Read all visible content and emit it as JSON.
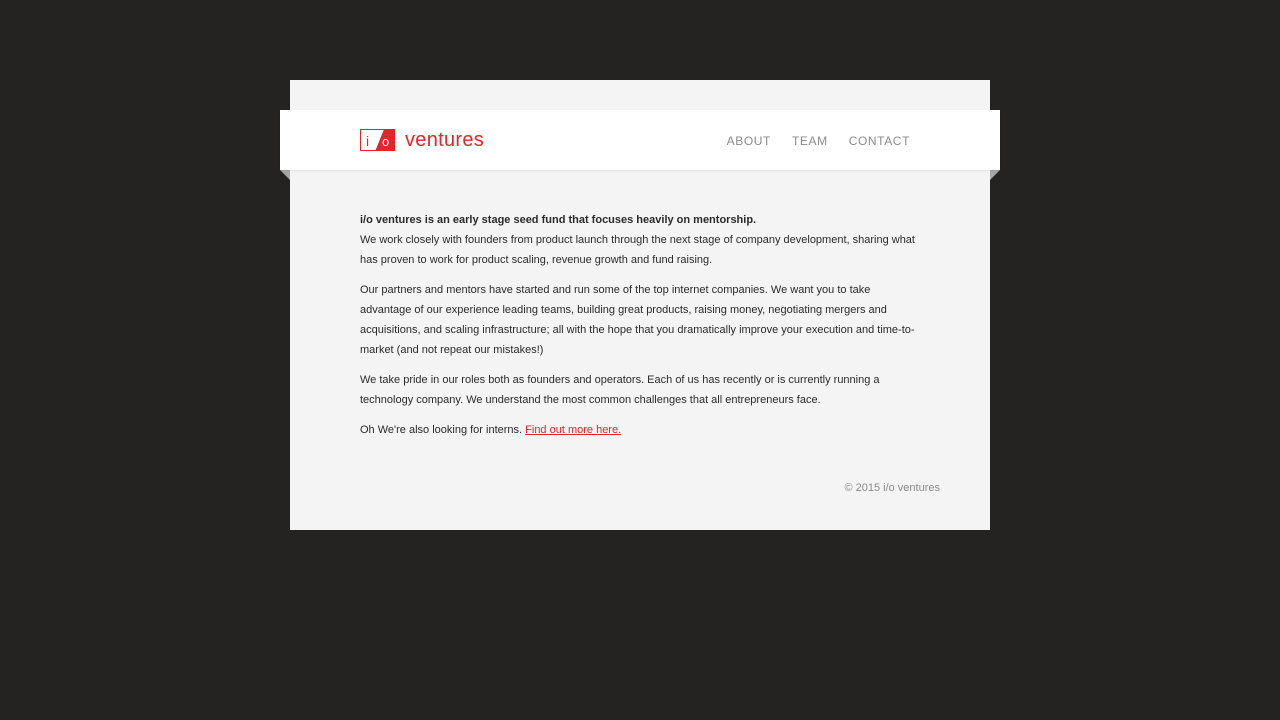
{
  "header": {
    "logo": {
      "mark_i": "i",
      "mark_o": "o",
      "wordmark": "ventures"
    },
    "nav": [
      {
        "label": "ABOUT"
      },
      {
        "label": "TEAM"
      },
      {
        "label": "CONTACT"
      }
    ]
  },
  "main": {
    "lead": "i/o ventures is an early stage seed fund that focuses heavily on mentorship.",
    "paragraph1": "We work closely with founders from product launch through the next stage of company development, sharing what has proven to work for product scaling, revenue growth and fund raising.",
    "paragraph2": "Our partners and mentors have started and run some of the top internet companies. We want you to take advantage of our experience leading teams, building great products, raising money, negotiating mergers and acquisitions, and scaling infrastructure; all with the hope that you dramatically improve your execution and time-to-market (and not repeat our mistakes!)",
    "paragraph3": "We take pride in our roles both as founders and operators. Each of us has recently or is currently running a technology company. We understand the most common challenges that all entrepreneurs face.",
    "interns_text": "Oh We're also looking for interns.",
    "interns_link": "Find out more here."
  },
  "footer": {
    "copyright": "© 2015 i/o ventures"
  },
  "colors": {
    "background": "#252321",
    "page": "#f4f4f4",
    "accent": "#e0262b",
    "nav_text": "#8a8a8a"
  }
}
